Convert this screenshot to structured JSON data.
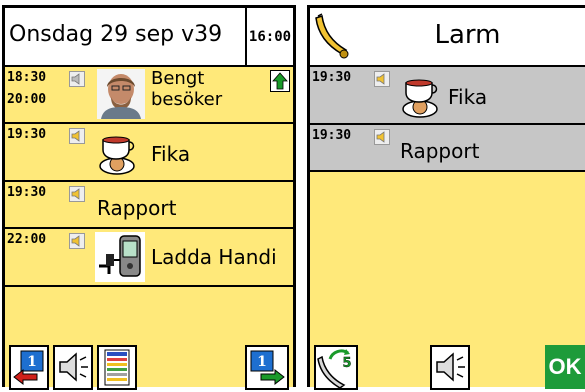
{
  "left": {
    "date": "Onsdag 29 sep v39",
    "clock": "16:00",
    "events": [
      {
        "start": "18:30",
        "end": "20:00",
        "title_line1": "Bengt",
        "title_line2": "besöker",
        "icon": "person-photo"
      },
      {
        "start": "19:30",
        "title": "Fika",
        "icon": "coffee-icon"
      },
      {
        "start": "19:30",
        "title": "Rapport"
      },
      {
        "start": "22:00",
        "title": "Ladda Handi",
        "icon": "phone-charger-icon"
      }
    ],
    "toolbar": [
      "back-arrow-icon",
      "speaker-icon",
      "schedule-list-icon",
      "forward-arrow-icon"
    ]
  },
  "right": {
    "title": "Larm",
    "alarms": [
      {
        "time": "19:30",
        "title": "Fika",
        "icon": "coffee-icon"
      },
      {
        "time": "19:30",
        "title": "Rapport"
      }
    ],
    "snooze_minutes": "5",
    "ok_label": "OK"
  },
  "colors": {
    "yellow": "#ffe97a",
    "gray": "#c6c6c6",
    "ok_green": "#1e9b3a"
  }
}
